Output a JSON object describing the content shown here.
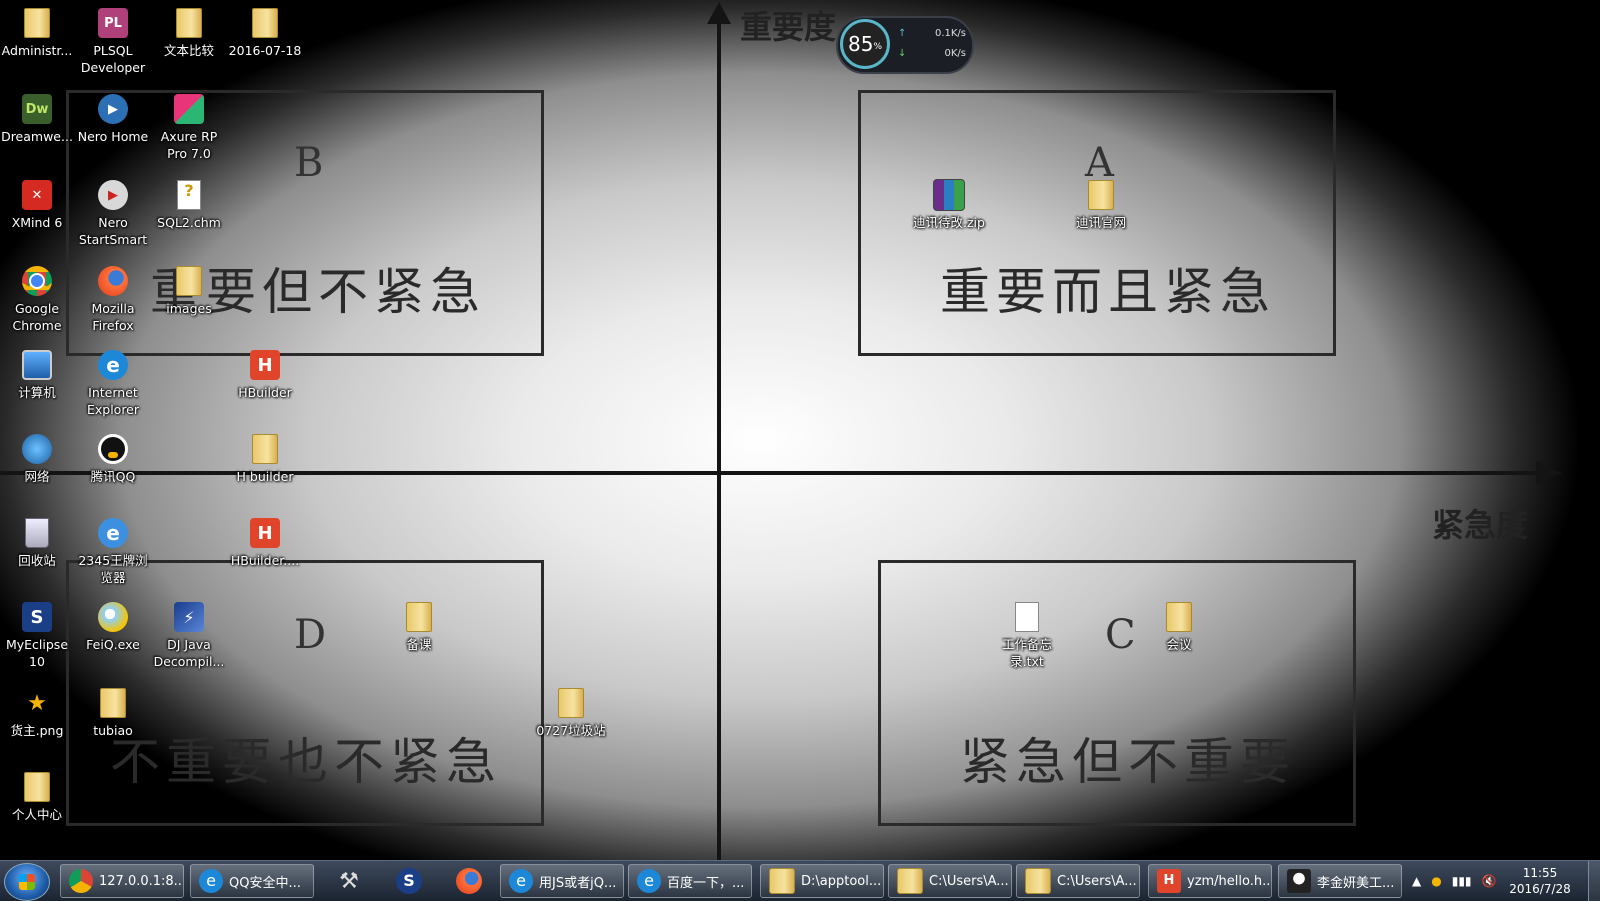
{
  "desktop": {
    "axes": {
      "y_label": "重要度",
      "x_label": "紧急度"
    },
    "quadrants": [
      {
        "letter": "B",
        "title": "重要但不紧急"
      },
      {
        "letter": "A",
        "title": "重要而且紧急"
      },
      {
        "letter": "D",
        "title": "不重要也不紧急"
      },
      {
        "letter": "C",
        "title": "紧急但不重要"
      }
    ],
    "icons": [
      {
        "label": "Administr...",
        "icon": "user-folder-icon"
      },
      {
        "label": "PLSQL Developer",
        "icon": "plsql-icon"
      },
      {
        "label": "文本比较",
        "icon": "folder-icon"
      },
      {
        "label": "2016-07-18",
        "icon": "folder-icon"
      },
      {
        "label": "Dreamwe...",
        "icon": "dreamweaver-icon"
      },
      {
        "label": "Nero Home",
        "icon": "nero-icon"
      },
      {
        "label": "Axure RP Pro 7.0",
        "icon": "axure-icon"
      },
      {
        "label": "XMind 6",
        "icon": "xmind-icon"
      },
      {
        "label": "Nero StartSmart",
        "icon": "nero-icon"
      },
      {
        "label": "SQL2.chm",
        "icon": "help-file-icon"
      },
      {
        "label": "Google Chrome",
        "icon": "chrome-icon"
      },
      {
        "label": "Mozilla Firefox",
        "icon": "firefox-icon"
      },
      {
        "label": "images",
        "icon": "folder-icon"
      },
      {
        "label": "计算机",
        "icon": "computer-icon"
      },
      {
        "label": "Internet Explorer",
        "icon": "ie-icon"
      },
      {
        "label": "HBuilder",
        "icon": "hbuilder-icon"
      },
      {
        "label": "网络",
        "icon": "network-icon"
      },
      {
        "label": "腾讯QQ",
        "icon": "qq-icon"
      },
      {
        "label": "H builder",
        "icon": "folder-icon"
      },
      {
        "label": "回收站",
        "icon": "recycle-bin-icon"
      },
      {
        "label": "2345王牌浏览器",
        "icon": "browser-2345-icon"
      },
      {
        "label": "HBuilder....",
        "icon": "hbuilder-icon"
      },
      {
        "label": "MyEclipse 10",
        "icon": "myeclipse-icon"
      },
      {
        "label": "FeiQ.exe",
        "icon": "feiq-icon"
      },
      {
        "label": "DJ Java Decompil...",
        "icon": "dj-java-icon"
      },
      {
        "label": "备课",
        "icon": "folder-icon"
      },
      {
        "label": "货主.png",
        "icon": "image-file-icon"
      },
      {
        "label": "tubiao",
        "icon": "folder-icon"
      },
      {
        "label": "0727垃圾站",
        "icon": "folder-icon"
      },
      {
        "label": "个人中心",
        "icon": "folder-icon"
      },
      {
        "label": "迪讯待改.zip",
        "icon": "zip-archive-icon"
      },
      {
        "label": "迪讯官网",
        "icon": "folder-icon"
      },
      {
        "label": "工作备忘录.txt",
        "icon": "text-file-icon"
      },
      {
        "label": "会议",
        "icon": "folder-icon"
      }
    ]
  },
  "netmeter": {
    "percent": "85",
    "percent_unit": "%",
    "upload": "0.1K/s",
    "download": "0K/s"
  },
  "taskbar": {
    "buttons": [
      {
        "label": "127.0.0.1:8...",
        "icon": "chrome-icon"
      },
      {
        "label": "QQ安全中...",
        "icon": "ie-icon"
      },
      {
        "label": "",
        "icon": "tools-icon"
      },
      {
        "label": "",
        "icon": "myeclipse-icon"
      },
      {
        "label": "",
        "icon": "firefox-icon"
      },
      {
        "label": "用JS或者jQ...",
        "icon": "ie-icon"
      },
      {
        "label": "百度一下，...",
        "icon": "ie-icon"
      },
      {
        "label": "D:\\apptool...",
        "icon": "folder-icon"
      },
      {
        "label": "C:\\Users\\A...",
        "icon": "folder-icon"
      },
      {
        "label": "C:\\Users\\A...",
        "icon": "folder-icon"
      },
      {
        "label": "yzm/hello.h...",
        "icon": "hbuilder-icon"
      },
      {
        "label": "李金妍美工...",
        "icon": "avatar-icon"
      }
    ],
    "tray": {
      "time": "11:55",
      "date": "2016/7/28"
    }
  },
  "colors": {
    "hbuilder": "#e0442a",
    "chrome_red": "#db4437",
    "ie_blue": "#1e88d8"
  }
}
